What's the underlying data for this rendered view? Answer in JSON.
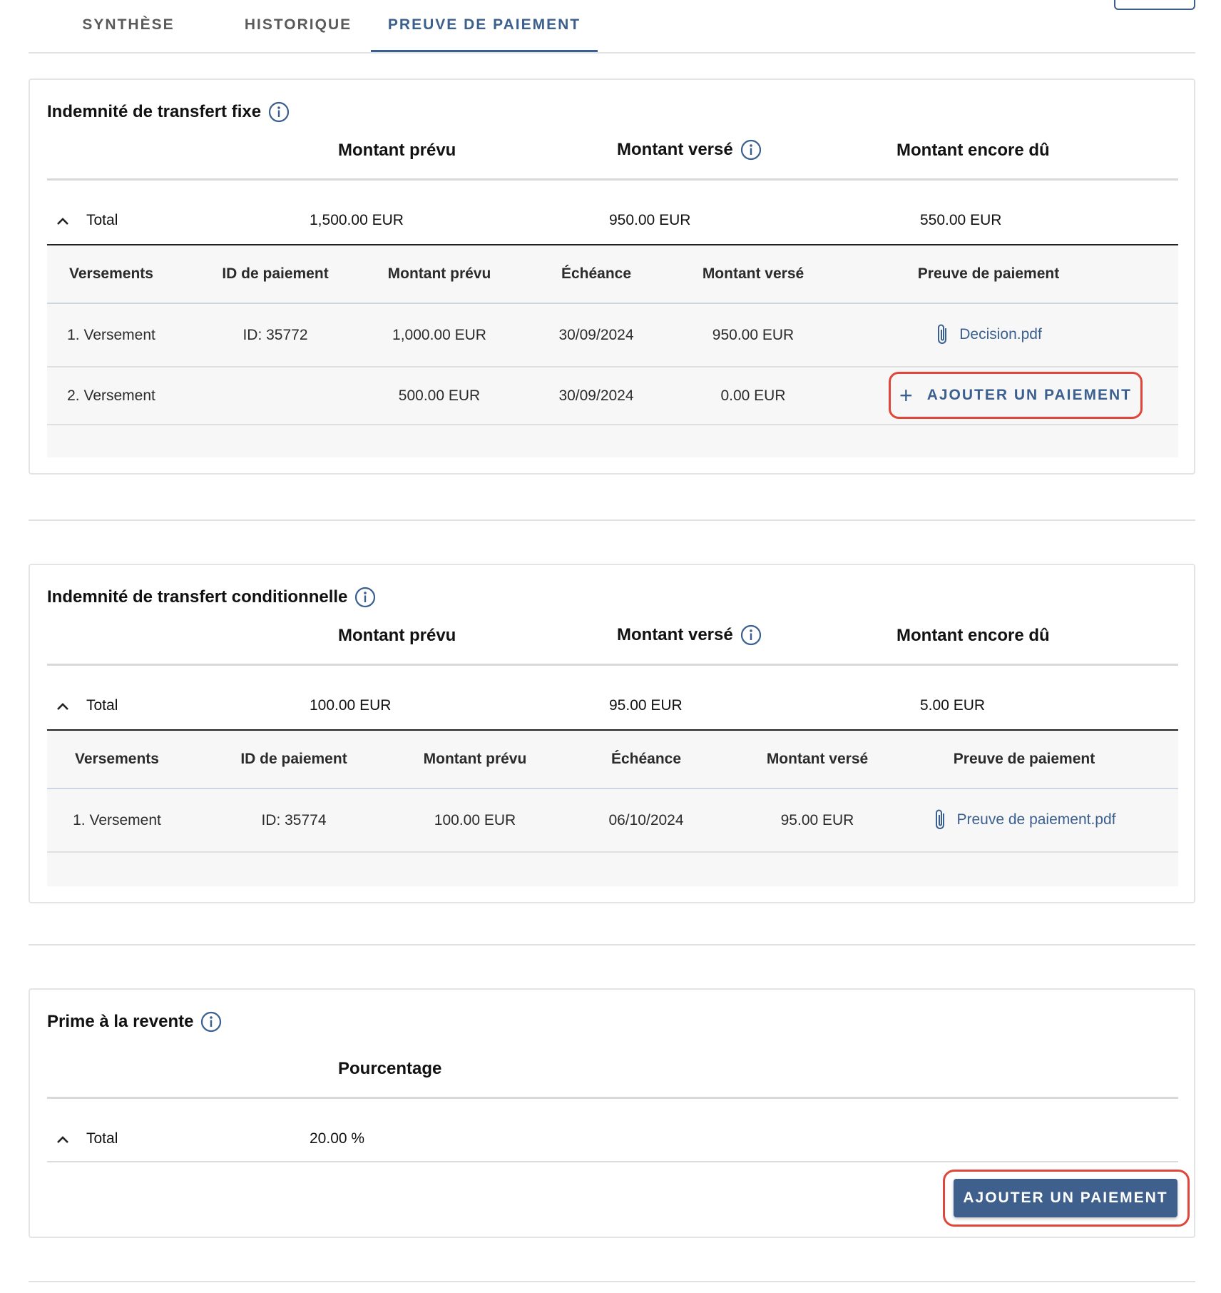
{
  "tabs": [
    {
      "label": "SYNTHÈSE"
    },
    {
      "label": "HISTORIQUE"
    },
    {
      "label": "PREUVE DE PAIEMENT"
    }
  ],
  "fixed": {
    "title": "Indemnité de transfert fixe",
    "headers": {
      "planned": "Montant prévu",
      "paid": "Montant versé",
      "due": "Montant encore dû"
    },
    "total": {
      "label": "Total",
      "planned": "1,500.00 EUR",
      "paid": "950.00 EUR",
      "due": "550.00 EUR"
    },
    "columns": [
      "Versements",
      "ID de paiement",
      "Montant prévu",
      "Échéance",
      "Montant versé",
      "Preuve de paiement"
    ],
    "rows": [
      {
        "name": "1. Versement",
        "id": "ID: 35772",
        "planned": "1,000.00 EUR",
        "date": "30/09/2024",
        "paid": "950.00 EUR",
        "proof": "Decision.pdf"
      },
      {
        "name": "2. Versement",
        "id": "",
        "planned": "500.00 EUR",
        "date": "30/09/2024",
        "paid": "0.00 EUR",
        "proof_action": "AJOUTER UN PAIEMENT"
      }
    ]
  },
  "conditional": {
    "title": "Indemnité de transfert conditionnelle",
    "headers": {
      "planned": "Montant prévu",
      "paid": "Montant versé",
      "due": "Montant encore dû"
    },
    "total": {
      "label": "Total",
      "planned": "100.00 EUR",
      "paid": "95.00 EUR",
      "due": "5.00 EUR"
    },
    "columns": [
      "Versements",
      "ID de paiement",
      "Montant prévu",
      "Échéance",
      "Montant versé",
      "Preuve de paiement"
    ],
    "rows": [
      {
        "name": "1. Versement",
        "id": "ID: 35774",
        "planned": "100.00 EUR",
        "date": "06/10/2024",
        "paid": "95.00 EUR",
        "proof": "Preuve de paiement.pdf"
      }
    ]
  },
  "resale": {
    "title": "Prime à la revente",
    "header": "Pourcentage",
    "total": {
      "label": "Total",
      "value": "20.00 %"
    },
    "action": "AJOUTER UN PAIEMENT"
  }
}
